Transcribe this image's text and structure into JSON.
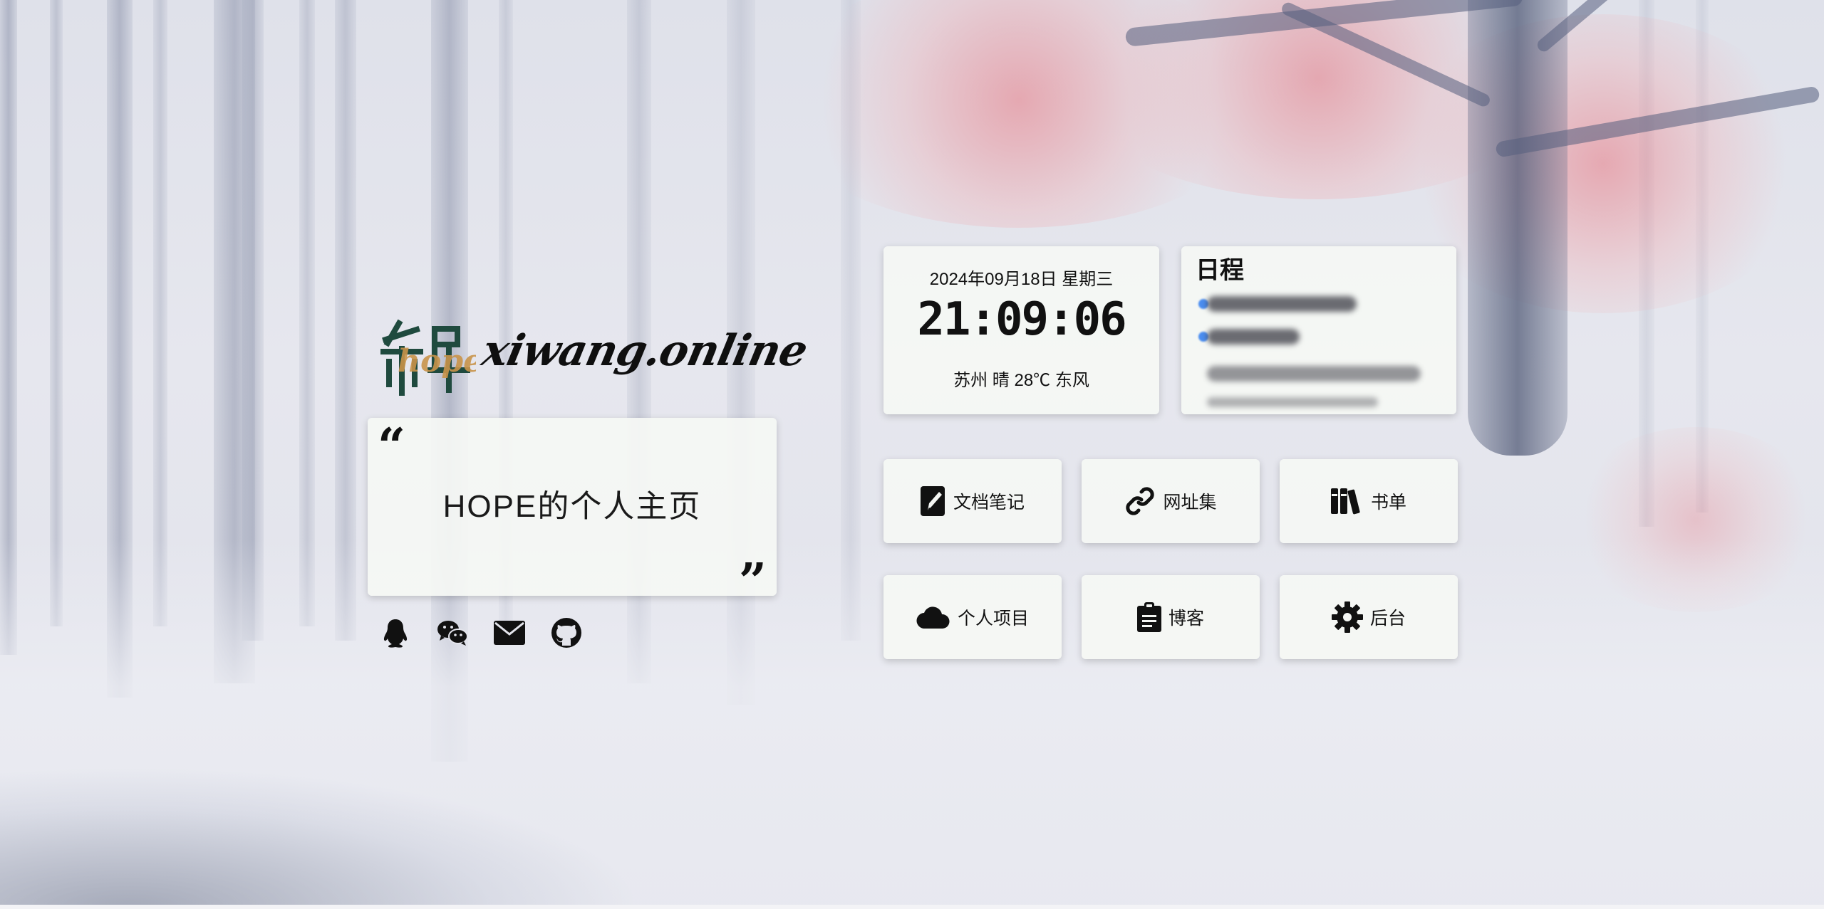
{
  "site": {
    "logo_text": "希望",
    "logo_overlay": "hope",
    "domain": "xiwang.online"
  },
  "quote": {
    "open_mark": "“",
    "text": "HOPE的个人主页",
    "close_mark": "”"
  },
  "social": [
    {
      "icon": "qq-icon"
    },
    {
      "icon": "wechat-icon"
    },
    {
      "icon": "mail-icon"
    },
    {
      "icon": "github-icon"
    }
  ],
  "clock": {
    "date": "2024年09月18日  星期三",
    "time": "21:09:06",
    "weather": "苏州  晴  28℃  东风"
  },
  "schedule": {
    "title": "日程"
  },
  "tiles": [
    {
      "label": "文档笔记",
      "icon": "notebook-pen-icon"
    },
    {
      "label": "网址集",
      "icon": "link-icon"
    },
    {
      "label": "书单",
      "icon": "books-icon"
    },
    {
      "label": "个人项目",
      "icon": "cloud-icon"
    },
    {
      "label": "博客",
      "icon": "clipboard-icon"
    },
    {
      "label": "后台",
      "icon": "gear-icon"
    }
  ]
}
